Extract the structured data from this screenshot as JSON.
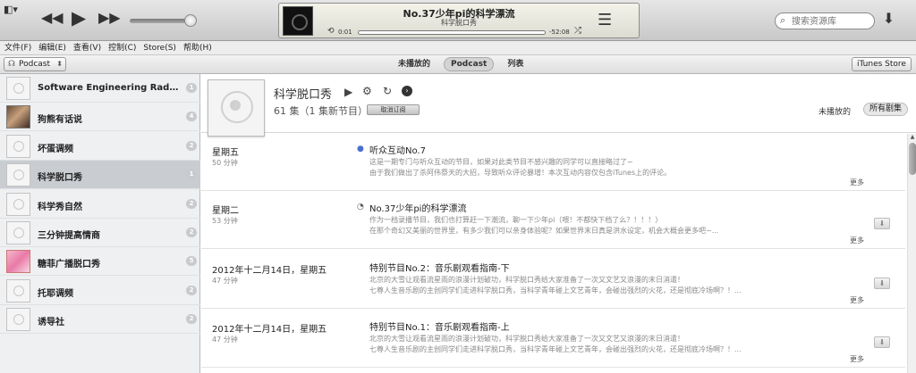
{
  "player": {
    "now_playing_title": "No.37少年pi的科学漂流",
    "now_playing_show": "科学脱口秀",
    "elapsed": "0:01",
    "remaining": "-52:08"
  },
  "search": {
    "placeholder": "搜索资源库"
  },
  "menu": [
    "文件(F)",
    "编辑(E)",
    "查看(V)",
    "控制(C)",
    "Store(S)",
    "帮助(H)"
  ],
  "nav": {
    "source": "Podcast",
    "tabs": [
      "未播放的",
      "Podcast",
      "列表"
    ],
    "active_tab": "Podcast",
    "store_button": "iTunes Store"
  },
  "sidebar": {
    "items": [
      {
        "name": "Software Engineering Radio - th...",
        "count": "1"
      },
      {
        "name": "狗熊有话说",
        "count": "4"
      },
      {
        "name": "坏蛋调频",
        "count": "2"
      },
      {
        "name": "科学脱口秀",
        "count": "1"
      },
      {
        "name": "科学秀自然",
        "count": "2"
      },
      {
        "name": "三分钟提高情商",
        "count": "2"
      },
      {
        "name": "糖菲广播脱口秀",
        "count": "5"
      },
      {
        "name": "托耶调频",
        "count": "2"
      },
      {
        "name": "诱导社",
        "count": "2"
      }
    ],
    "selected_index": 3
  },
  "podcast": {
    "title": "科学脱口秀",
    "count_text": "61 集（1 集新节目）",
    "unsubscribe_label": "取消订阅",
    "filter_unplayed": "未播放的",
    "filter_all": "所有剧集"
  },
  "episodes": [
    {
      "date": "星期五",
      "duration": "50 分钟",
      "status": "new",
      "title": "听众互动No.7",
      "desc1": "这是一期专门与听众互动的节目，如果对此类节目不感兴趣的同学可以直接略过了~",
      "desc2": "由于我们做出了杀阿伟祭天的大招，导致听众评论暴增！本次互动内容仅包含iTunes上的评论。",
      "more": "更多"
    },
    {
      "date": "星期二",
      "duration": "53 分钟",
      "status": "partial",
      "title": "No.37少年pi的科学漂流",
      "desc1": "作为一档录播节目，我们也打算赶一下潮流，聊一下少年pi（喂！不都快下档了么？！！！）",
      "desc2": "在那个奇幻又美丽的世界里，有多少我们可以亲身体验呢？如果世界末日真是洪水设定，机会大概会更多吧~...",
      "more": "更多"
    },
    {
      "date": "2012年十二月14日，星期五",
      "duration": "47 分钟",
      "status": "",
      "title": "特别节目No.2：音乐剧观看指南-下",
      "desc1": "北京的大雪让观看流星雨的浪漫计划破功，科学脱口秀给大家准备了一次又文艺又浪漫的末日消遣！",
      "desc2": "七尊人生音乐剧的主创同学们走进科学脱口秀，当科学青年碰上文艺青年，会碰出强烈的火花，还是彻底冷场啊？！...",
      "more": "更多"
    },
    {
      "date": "2012年十二月14日，星期五",
      "duration": "47 分钟",
      "status": "",
      "title": "特别节目No.1：音乐剧观看指南-上",
      "desc1": "北京的大雪让观看流星雨的浪漫计划破功，科学脱口秀给大家准备了一次又文艺又浪漫的末日消遣！",
      "desc2": "七尊人生音乐剧的主创同学们走进科学脱口秀，当科学青年碰上文艺青年，会碰出强烈的火花，还是彻底冷场啊？！...",
      "more": "更多"
    }
  ]
}
